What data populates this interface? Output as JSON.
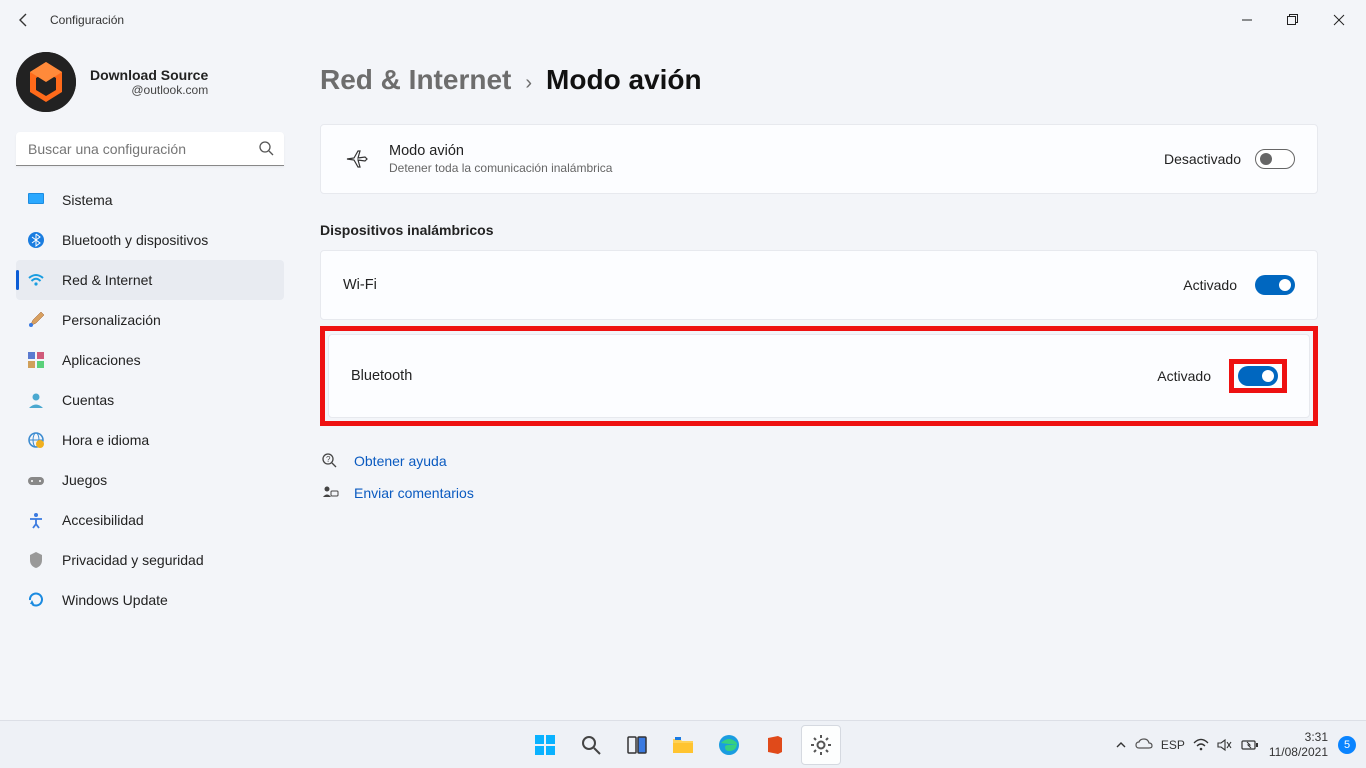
{
  "window": {
    "title": "Configuración"
  },
  "profile": {
    "name": "Download Source",
    "email": "@outlook.com"
  },
  "search": {
    "placeholder": "Buscar una configuración"
  },
  "nav": {
    "items": [
      {
        "label": "Sistema"
      },
      {
        "label": "Bluetooth y dispositivos"
      },
      {
        "label": "Red & Internet"
      },
      {
        "label": "Personalización"
      },
      {
        "label": "Aplicaciones"
      },
      {
        "label": "Cuentas"
      },
      {
        "label": "Hora e idioma"
      },
      {
        "label": "Juegos"
      },
      {
        "label": "Accesibilidad"
      },
      {
        "label": "Privacidad y seguridad"
      },
      {
        "label": "Windows Update"
      }
    ],
    "active_index": 2
  },
  "breadcrumb": {
    "parent": "Red & Internet",
    "current": "Modo avión"
  },
  "airplane_card": {
    "title": "Modo avión",
    "subtitle": "Detener toda la comunicación inalámbrica",
    "status": "Desactivado",
    "on": false
  },
  "section_heading": "Dispositivos inalámbricos",
  "wifi": {
    "label": "Wi-Fi",
    "status": "Activado",
    "on": true
  },
  "bluetooth": {
    "label": "Bluetooth",
    "status": "Activado",
    "on": true
  },
  "links": {
    "help": "Obtener ayuda",
    "feedback": "Enviar comentarios"
  },
  "taskbar": {
    "lang": "ESP",
    "time": "3:31",
    "date": "11/08/2021",
    "notif_count": "5"
  }
}
